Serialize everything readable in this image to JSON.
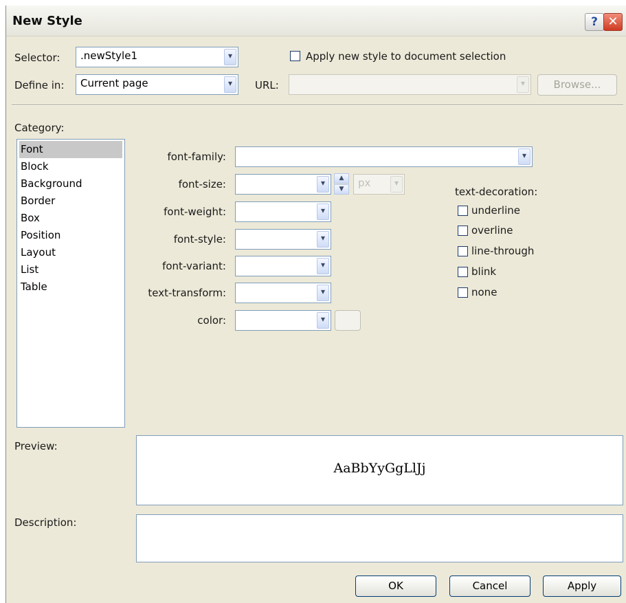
{
  "window": {
    "title": "New Style",
    "help_label": "?",
    "close_label": "✕"
  },
  "selector": {
    "label": "Selector:",
    "value": ".newStyle1"
  },
  "apply_new_style": {
    "label": "Apply new style to document selection",
    "checked": false
  },
  "define_in": {
    "label": "Define in:",
    "value": "Current page"
  },
  "url": {
    "label": "URL:",
    "value": ""
  },
  "browse_label": "Browse...",
  "category": {
    "label": "Category:",
    "items": [
      "Font",
      "Block",
      "Background",
      "Border",
      "Box",
      "Position",
      "Layout",
      "List",
      "Table"
    ],
    "selected": "Font"
  },
  "font_props": [
    {
      "label": "font-family:",
      "value": ""
    },
    {
      "label": "font-size:",
      "value": "",
      "unit": "px"
    },
    {
      "label": "font-weight:",
      "value": ""
    },
    {
      "label": "font-style:",
      "value": ""
    },
    {
      "label": "font-variant:",
      "value": ""
    },
    {
      "label": "text-transform:",
      "value": ""
    },
    {
      "label": "color:",
      "value": ""
    }
  ],
  "text_decoration": {
    "label": "text-decoration:",
    "options": [
      "underline",
      "overline",
      "line-through",
      "blink",
      "none"
    ],
    "checked": []
  },
  "preview": {
    "label": "Preview:",
    "sample": "AaBbYyGgLlJj"
  },
  "description": {
    "label": "Description:",
    "value": ""
  },
  "buttons": {
    "ok": "OK",
    "cancel": "Cancel",
    "apply": "Apply"
  },
  "dropdown_arrow": "▾",
  "spin_up": "▲",
  "spin_down": "▼",
  "colors": {
    "accent_border": "#7f9db9",
    "dialog_bg": "#ece9d8",
    "close_red": "#cf3a22"
  }
}
